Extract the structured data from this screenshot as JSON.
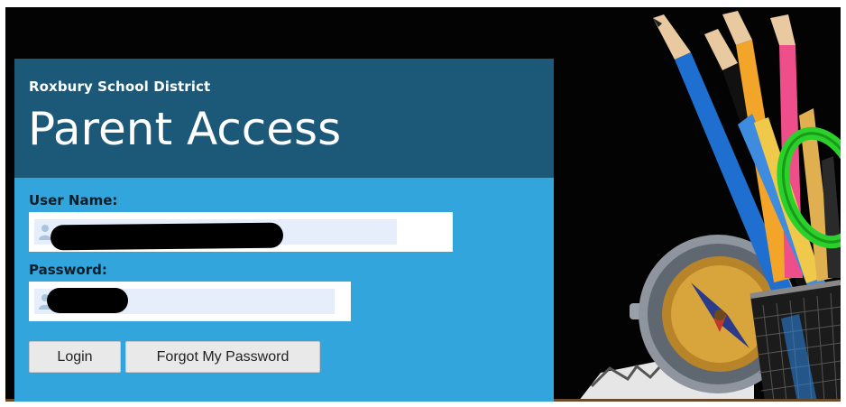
{
  "header": {
    "district": "Roxbury School District",
    "title": "Parent Access"
  },
  "form": {
    "username_label": "User Name:",
    "username_value": "",
    "password_label": "Password:",
    "password_value": "",
    "login_label": "Login",
    "forgot_label": "Forgot My Password"
  },
  "colors": {
    "header_bg": "#1c5878",
    "form_bg": "#32a6dc",
    "input_fill": "#e6eefb",
    "button_bg": "#e9e9e9"
  },
  "icons": {
    "username_field": "person-icon",
    "password_field": "person-icon"
  }
}
